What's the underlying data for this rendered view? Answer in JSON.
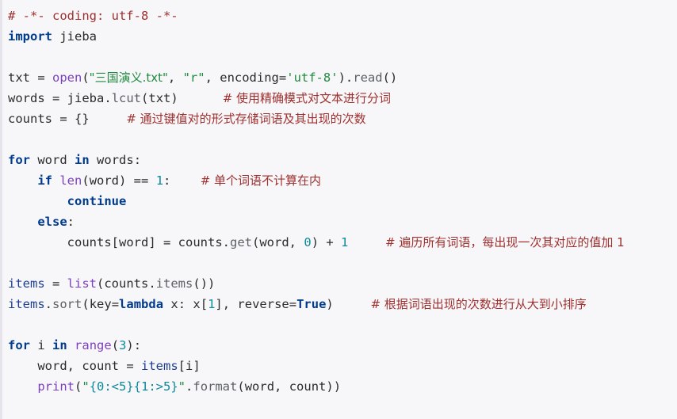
{
  "editor": {
    "language": "python",
    "background_color": "#f7f7f9",
    "gutter_color": "#e4e4ea",
    "colors": {
      "comment": "#a0302f",
      "keyword": "#003b8e",
      "builtin": "#7e3fbf",
      "string": "#1f8a3f",
      "number": "#0d8a9c",
      "identifier": "#2b2b2b",
      "attribute": "#5c6066"
    }
  },
  "code": {
    "lines": [
      {
        "id": "line-1",
        "tokens": [
          {
            "cls": "t-com",
            "text": "# -*- coding: utf-8 -*-"
          }
        ]
      },
      {
        "id": "line-2",
        "tokens": [
          {
            "cls": "t-kw",
            "text": "import"
          },
          {
            "cls": "t-op",
            "text": " "
          },
          {
            "cls": "t-name",
            "text": "jieba"
          }
        ]
      },
      {
        "id": "line-3",
        "tokens": []
      },
      {
        "id": "line-4",
        "tokens": [
          {
            "cls": "t-name",
            "text": "txt "
          },
          {
            "cls": "t-op",
            "text": "= "
          },
          {
            "cls": "t-bi",
            "text": "open"
          },
          {
            "cls": "t-op",
            "text": "("
          },
          {
            "cls": "t-str",
            "text": "\"三国演义.txt\""
          },
          {
            "cls": "t-op",
            "text": ", "
          },
          {
            "cls": "t-str",
            "text": "\"r\""
          },
          {
            "cls": "t-op",
            "text": ", "
          },
          {
            "cls": "t-name",
            "text": "encoding"
          },
          {
            "cls": "t-op",
            "text": "="
          },
          {
            "cls": "t-str",
            "text": "'utf-8'"
          },
          {
            "cls": "t-op",
            "text": ")."
          },
          {
            "cls": "t-attr",
            "text": "read"
          },
          {
            "cls": "t-op",
            "text": "()"
          }
        ]
      },
      {
        "id": "line-5",
        "tokens": [
          {
            "cls": "t-name",
            "text": "words "
          },
          {
            "cls": "t-op",
            "text": "= "
          },
          {
            "cls": "t-name",
            "text": "jieba"
          },
          {
            "cls": "t-op",
            "text": "."
          },
          {
            "cls": "t-attr",
            "text": "lcut"
          },
          {
            "cls": "t-op",
            "text": "("
          },
          {
            "cls": "t-name",
            "text": "txt"
          },
          {
            "cls": "t-op",
            "text": ")"
          },
          {
            "cls": "t-op",
            "text": "      "
          },
          {
            "cls": "t-com",
            "text": "# 使用精确模式对文本进行分词"
          }
        ]
      },
      {
        "id": "line-6",
        "tokens": [
          {
            "cls": "t-name",
            "text": "counts "
          },
          {
            "cls": "t-op",
            "text": "= {}"
          },
          {
            "cls": "t-op",
            "text": "     "
          },
          {
            "cls": "t-com",
            "text": "# 通过键值对的形式存储词语及其出现的次数"
          }
        ]
      },
      {
        "id": "line-7",
        "tokens": []
      },
      {
        "id": "line-8",
        "tokens": [
          {
            "cls": "t-kw",
            "text": "for"
          },
          {
            "cls": "t-op",
            "text": " "
          },
          {
            "cls": "t-name",
            "text": "word"
          },
          {
            "cls": "t-op",
            "text": " "
          },
          {
            "cls": "t-kw",
            "text": "in"
          },
          {
            "cls": "t-op",
            "text": " "
          },
          {
            "cls": "t-name",
            "text": "words"
          },
          {
            "cls": "t-op",
            "text": ":"
          }
        ]
      },
      {
        "id": "line-9",
        "tokens": [
          {
            "cls": "t-op",
            "text": "    "
          },
          {
            "cls": "t-kw",
            "text": "if"
          },
          {
            "cls": "t-op",
            "text": " "
          },
          {
            "cls": "t-bi",
            "text": "len"
          },
          {
            "cls": "t-op",
            "text": "("
          },
          {
            "cls": "t-name",
            "text": "word"
          },
          {
            "cls": "t-op",
            "text": ") == "
          },
          {
            "cls": "t-num",
            "text": "1"
          },
          {
            "cls": "t-op",
            "text": ":"
          },
          {
            "cls": "t-op",
            "text": "    "
          },
          {
            "cls": "t-com",
            "text": "# 单个词语不计算在内"
          }
        ]
      },
      {
        "id": "line-10",
        "tokens": [
          {
            "cls": "t-op",
            "text": "        "
          },
          {
            "cls": "t-kw",
            "text": "continue"
          }
        ]
      },
      {
        "id": "line-11",
        "tokens": [
          {
            "cls": "t-op",
            "text": "    "
          },
          {
            "cls": "t-kw",
            "text": "else"
          },
          {
            "cls": "t-op",
            "text": ":"
          }
        ]
      },
      {
        "id": "line-12",
        "tokens": [
          {
            "cls": "t-op",
            "text": "        "
          },
          {
            "cls": "t-name",
            "text": "counts"
          },
          {
            "cls": "t-op",
            "text": "["
          },
          {
            "cls": "t-name",
            "text": "word"
          },
          {
            "cls": "t-op",
            "text": "] = "
          },
          {
            "cls": "t-name",
            "text": "counts"
          },
          {
            "cls": "t-op",
            "text": "."
          },
          {
            "cls": "t-attr",
            "text": "get"
          },
          {
            "cls": "t-op",
            "text": "("
          },
          {
            "cls": "t-name",
            "text": "word"
          },
          {
            "cls": "t-op",
            "text": ", "
          },
          {
            "cls": "t-num",
            "text": "0"
          },
          {
            "cls": "t-op",
            "text": ") + "
          },
          {
            "cls": "t-num",
            "text": "1"
          },
          {
            "cls": "t-op",
            "text": "     "
          },
          {
            "cls": "t-com",
            "text": "# 遍历所有词语，每出现一次其对应的值加 1"
          }
        ]
      },
      {
        "id": "line-13",
        "tokens": []
      },
      {
        "id": "line-14",
        "tokens": [
          {
            "cls": "t-var",
            "text": "items "
          },
          {
            "cls": "t-op",
            "text": "= "
          },
          {
            "cls": "t-bi",
            "text": "list"
          },
          {
            "cls": "t-op",
            "text": "("
          },
          {
            "cls": "t-name",
            "text": "counts"
          },
          {
            "cls": "t-op",
            "text": "."
          },
          {
            "cls": "t-attr",
            "text": "items"
          },
          {
            "cls": "t-op",
            "text": "())"
          }
        ]
      },
      {
        "id": "line-15",
        "tokens": [
          {
            "cls": "t-var",
            "text": "items"
          },
          {
            "cls": "t-op",
            "text": "."
          },
          {
            "cls": "t-attr",
            "text": "sort"
          },
          {
            "cls": "t-op",
            "text": "("
          },
          {
            "cls": "t-name",
            "text": "key"
          },
          {
            "cls": "t-op",
            "text": "="
          },
          {
            "cls": "t-kw",
            "text": "lambda"
          },
          {
            "cls": "t-op",
            "text": " "
          },
          {
            "cls": "t-name",
            "text": "x"
          },
          {
            "cls": "t-op",
            "text": ": "
          },
          {
            "cls": "t-name",
            "text": "x"
          },
          {
            "cls": "t-op",
            "text": "["
          },
          {
            "cls": "t-num",
            "text": "1"
          },
          {
            "cls": "t-op",
            "text": "], "
          },
          {
            "cls": "t-name",
            "text": "reverse"
          },
          {
            "cls": "t-op",
            "text": "="
          },
          {
            "cls": "t-kw",
            "text": "True"
          },
          {
            "cls": "t-op",
            "text": ")"
          },
          {
            "cls": "t-op",
            "text": "     "
          },
          {
            "cls": "t-com",
            "text": "# 根据词语出现的次数进行从大到小排序"
          }
        ]
      },
      {
        "id": "line-16",
        "tokens": []
      },
      {
        "id": "line-17",
        "tokens": [
          {
            "cls": "t-kw",
            "text": "for"
          },
          {
            "cls": "t-op",
            "text": " "
          },
          {
            "cls": "t-name",
            "text": "i"
          },
          {
            "cls": "t-op",
            "text": " "
          },
          {
            "cls": "t-kw",
            "text": "in"
          },
          {
            "cls": "t-op",
            "text": " "
          },
          {
            "cls": "t-bi",
            "text": "range"
          },
          {
            "cls": "t-op",
            "text": "("
          },
          {
            "cls": "t-num",
            "text": "3"
          },
          {
            "cls": "t-op",
            "text": "):"
          }
        ]
      },
      {
        "id": "line-18",
        "tokens": [
          {
            "cls": "t-op",
            "text": "    "
          },
          {
            "cls": "t-name",
            "text": "word"
          },
          {
            "cls": "t-op",
            "text": ", "
          },
          {
            "cls": "t-name",
            "text": "count"
          },
          {
            "cls": "t-op",
            "text": " = "
          },
          {
            "cls": "t-var",
            "text": "items"
          },
          {
            "cls": "t-op",
            "text": "["
          },
          {
            "cls": "t-name",
            "text": "i"
          },
          {
            "cls": "t-op",
            "text": "]"
          }
        ]
      },
      {
        "id": "line-19",
        "tokens": [
          {
            "cls": "t-op",
            "text": "    "
          },
          {
            "cls": "t-bi",
            "text": "print"
          },
          {
            "cls": "t-op",
            "text": "("
          },
          {
            "cls": "t-str",
            "text": "\""
          },
          {
            "cls": "t-fmt",
            "text": "{0:<5}{1:>5}"
          },
          {
            "cls": "t-str",
            "text": "\""
          },
          {
            "cls": "t-op",
            "text": "."
          },
          {
            "cls": "t-attr",
            "text": "format"
          },
          {
            "cls": "t-op",
            "text": "("
          },
          {
            "cls": "t-name",
            "text": "word"
          },
          {
            "cls": "t-op",
            "text": ", "
          },
          {
            "cls": "t-name",
            "text": "count"
          },
          {
            "cls": "t-op",
            "text": "))"
          }
        ]
      }
    ]
  }
}
